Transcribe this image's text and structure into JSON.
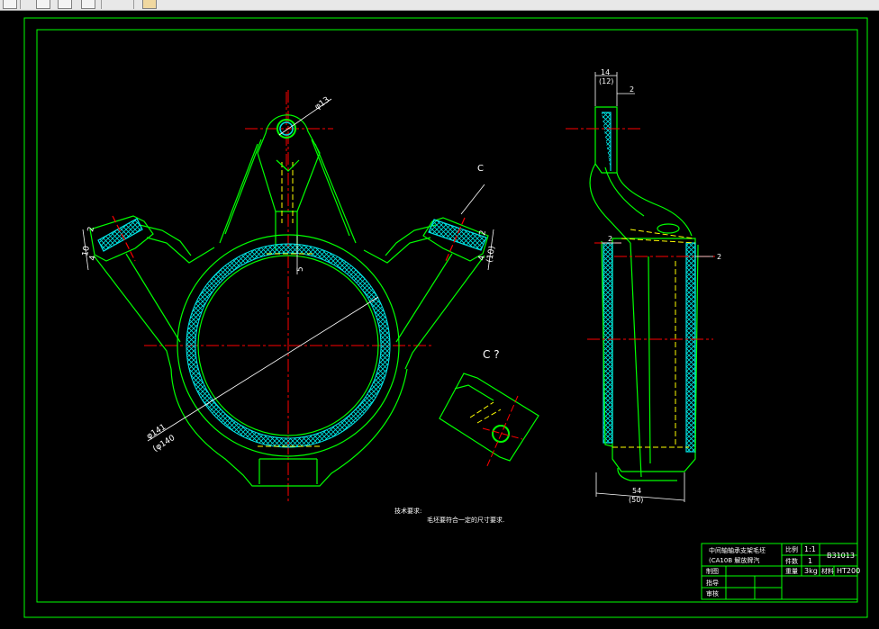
{
  "toolbar": {
    "icons": [
      "cut-icon",
      "copy-icon",
      "paste-icon",
      "undo-icon",
      "match-properties-icon"
    ]
  },
  "views": {
    "section_label": "C ?",
    "arrow_label": "C"
  },
  "dimensions": {
    "hole_dia": "φ13",
    "bore_dia": "φ141",
    "bore_dia_ref": "(φ140",
    "wall": "5",
    "left_2": "2",
    "left_4": "4",
    "left_10": "10",
    "right_2": "2",
    "right_4": "4",
    "right_10": "(10)",
    "side_14": "14",
    "side_12": "(12)",
    "side_2_top": "2",
    "side_2_left": "2",
    "side_2_right": "2",
    "side_54": "54",
    "side_50": "(50)"
  },
  "notes": {
    "title": "技术要求:",
    "line1": "毛坯要符合一定的尺寸要求."
  },
  "title_block": {
    "part_name": "中间轴轴承支架毛坯",
    "model": "(CA10B  解放牌汽",
    "drawn": "制图",
    "guide": "指导",
    "review": "审核",
    "scale_label": "比例",
    "scale": "1:1",
    "qty_label": "件数",
    "qty": "1",
    "weight_label": "重量",
    "weight": "3kg",
    "material_label": "材料",
    "material": "HT200",
    "drawing_no": "B31013"
  },
  "colors": {
    "outline": "#00ff00",
    "center": "#ff0000",
    "hidden": "#ffff00",
    "hatch": "#00e5e5",
    "dim": "#ffffff"
  }
}
